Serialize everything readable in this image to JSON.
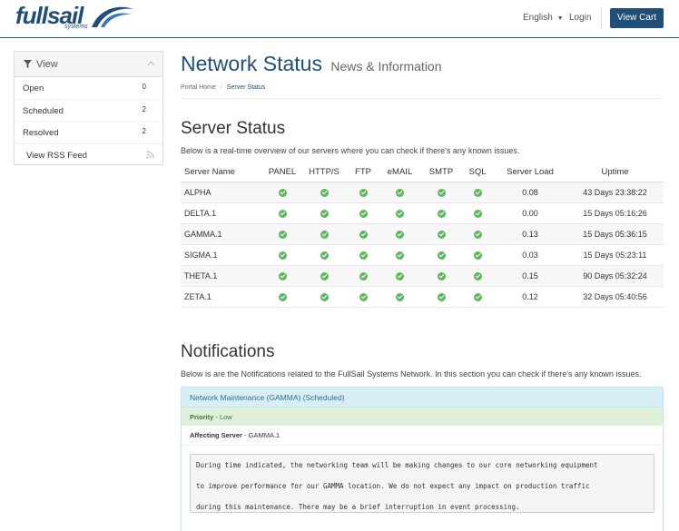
{
  "header": {
    "logo_text": "fullsail",
    "logo_sub": "systems",
    "language": "English",
    "login": "Login",
    "cart_button": "View Cart",
    "brand_color": "#1f4e79"
  },
  "sidebar": {
    "title": "View",
    "items": [
      {
        "label": "Open",
        "count": "0"
      },
      {
        "label": "Scheduled",
        "count": "2"
      },
      {
        "label": "Resolved",
        "count": "2"
      }
    ],
    "rss_label": "View RSS Feed"
  },
  "page": {
    "title": "Network Status",
    "subtitle": "News & Information",
    "breadcrumb": [
      "Portal Home",
      "Server Status"
    ]
  },
  "server_status": {
    "heading": "Server Status",
    "description": "Below is a real-time overview of our servers where you can check if there's any known issues.",
    "columns": [
      "Server Name",
      "PANEL",
      "HTTP/S",
      "FTP",
      "eMAIL",
      "SMTP",
      "SQL",
      "Server Load",
      "Uptime"
    ],
    "rows": [
      {
        "name": "ALPHA",
        "load": "0.08",
        "uptime": "43 Days 23:38:22"
      },
      {
        "name": "DELTA.1",
        "load": "0.00",
        "uptime": "15 Days 05:16:26"
      },
      {
        "name": "GAMMA.1",
        "load": "0.13",
        "uptime": "15 Days 05:36:15"
      },
      {
        "name": "SIGMA.1",
        "load": "0.03",
        "uptime": "15 Days 05:23:11"
      },
      {
        "name": "THETA.1",
        "load": "0.15",
        "uptime": "90 Days 05:32:24"
      },
      {
        "name": "ZETA.1",
        "load": "0.12",
        "uptime": "32 Days 05:40:56"
      }
    ],
    "status_color": "#5cb85c"
  },
  "notifications": {
    "heading": "Notifications",
    "description": "Below is are the Notifications related to the FullSail Systems Network. In this section you can check if there's any known issues.",
    "title": "Network Maintenance (GAMMA) (Scheduled)",
    "priority_label": "Priority",
    "priority_value": "Low",
    "server_label": "Affecting Server",
    "server_value": "GAMMA.1",
    "message_lines": [
      "During time indicated, the networking team will be making changes to our core networking equipment",
      "to improve performance for our GAMMA location. We do not expect any impact on production traffic",
      "during this maintenance. There may be a brief interruption in event processing."
    ]
  }
}
